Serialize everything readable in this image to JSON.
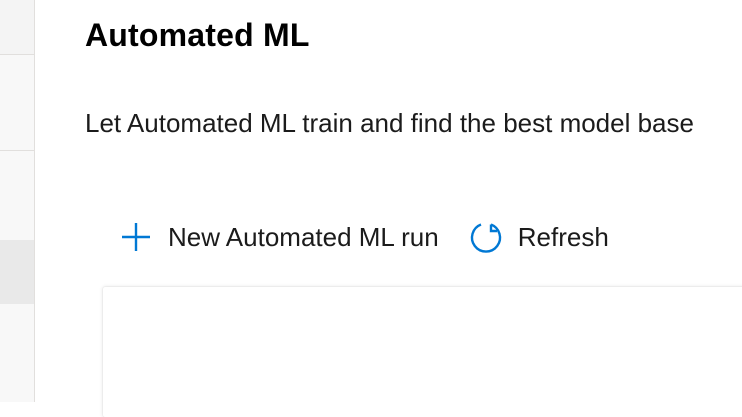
{
  "page": {
    "title": "Automated ML",
    "description": "Let Automated ML train and find the best model base"
  },
  "toolbar": {
    "new_run": {
      "label": "New Automated ML run",
      "icon": "plus-icon"
    },
    "refresh": {
      "label": "Refresh",
      "icon": "refresh-icon"
    }
  },
  "colors": {
    "accent": "#0078d4",
    "sidebar_bg": "#f4f4f4",
    "sidebar_selected": "#e9e9e9",
    "divider": "#e1dfdd"
  }
}
